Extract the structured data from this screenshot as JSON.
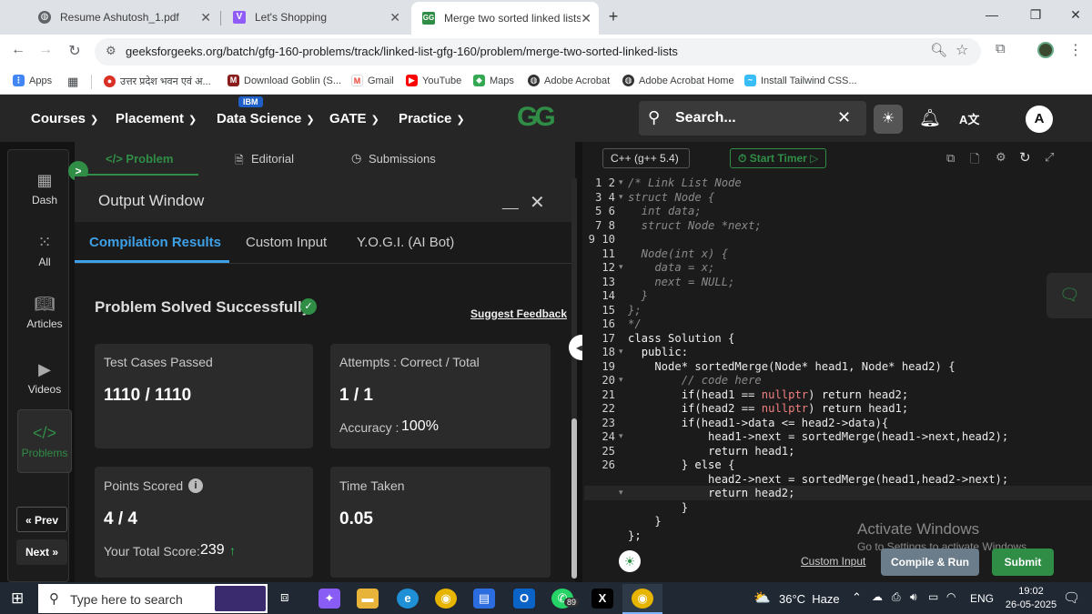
{
  "browser": {
    "tabs": [
      {
        "title": "Resume Ashutosh_1.pdf",
        "icon": "pdf-icon"
      },
      {
        "title": "Let's Shopping",
        "icon": "vite-icon"
      },
      {
        "title": "Merge two sorted linked lists |",
        "icon": "gfg-icon",
        "active": true
      }
    ],
    "url": "geeksforgeeks.org/batch/gfg-160-problems/track/linked-list-gfg-160/problem/merge-two-sorted-linked-lists",
    "bookmarks": [
      "Apps",
      "उत्तर प्रदेश भवन एवं अ...",
      "Download Goblin (S...",
      "Gmail",
      "YouTube",
      "Maps",
      "Adobe Acrobat",
      "Adobe Acrobat Home",
      "Install Tailwind CSS..."
    ]
  },
  "header": {
    "menus": [
      "Courses",
      "Placement",
      "Data Science",
      "GATE",
      "Practice"
    ],
    "ibm_badge": "IBM",
    "search_placeholder": "Search...",
    "avatar_letter": "A",
    "logo_text": "GG"
  },
  "rail": {
    "items": [
      {
        "label": "Dash"
      },
      {
        "label": "All"
      },
      {
        "label": "Articles"
      },
      {
        "label": "Videos"
      },
      {
        "label": "Problems"
      }
    ],
    "prev": "« Prev",
    "next": "Next »"
  },
  "problem_tabs": [
    "</> Problem",
    "Editorial",
    "Submissions"
  ],
  "output": {
    "title": "Output Window",
    "tabs": [
      "Compilation Results",
      "Custom Input",
      "Y.O.G.I. (AI Bot)"
    ],
    "status": "Problem Solved Successfully",
    "suggest": "Suggest Feedback",
    "test_cases_label": "Test Cases Passed",
    "test_cases_value": "1110 / 1110",
    "attempts_label": "Attempts : Correct / Total",
    "attempts_value": "1 / 1",
    "accuracy_label": "Accuracy :",
    "accuracy_value": "100%",
    "points_label": "Points Scored",
    "points_value": "4 / 4",
    "total_label": "Your Total Score:",
    "total_value": "239",
    "time_label": "Time Taken",
    "time_value": "0.05"
  },
  "editor": {
    "language": "C++ (g++ 5.4)",
    "timer": "Start Timer",
    "custom_input": "Custom Input",
    "compile": "Compile & Run",
    "submit": "Submit",
    "watermark_title": "Activate Windows",
    "watermark_sub": "Go to Settings to activate Windows."
  },
  "taskbar": {
    "search": "Type here to search",
    "weather": "36°C  Haze",
    "lang": "ENG",
    "time": "19:02",
    "date": "26-05-2025",
    "whatsapp_badge": "89"
  }
}
